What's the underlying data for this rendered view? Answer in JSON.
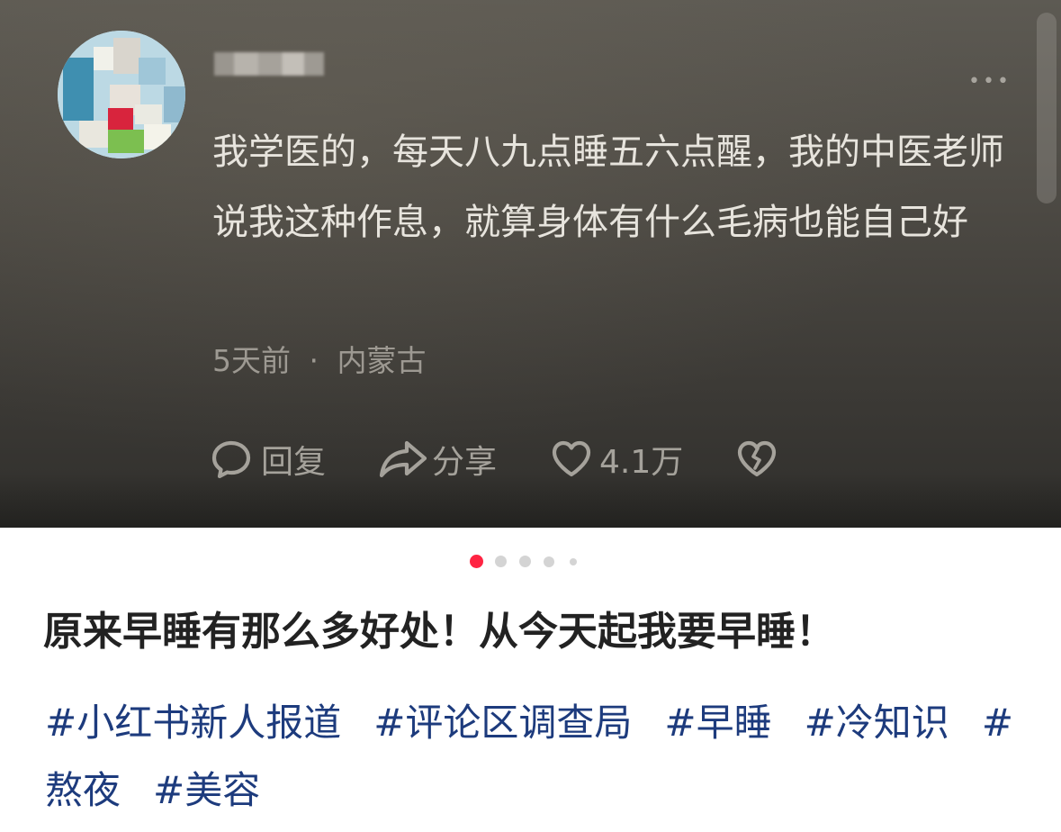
{
  "comment_card": {
    "comment_text": "我学医的，每天八九点睡五六点醒，我的中医老师说我这种作息，就算身体有什么毛病也能自己好",
    "time": "5天前",
    "separator": "·",
    "location": "内蒙古",
    "actions": {
      "reply_label": "回复",
      "share_label": "分享",
      "like_count": "4.1万"
    },
    "icons": {
      "reply": "speech-bubble-icon",
      "share": "share-arrow-icon",
      "like": "heart-icon",
      "dislike": "broken-heart-icon",
      "more": "more-dots-icon"
    }
  },
  "pager": {
    "total": 5,
    "active_index": 0,
    "active_color": "#ff2442",
    "inactive_color": "#d4d4d4"
  },
  "post": {
    "title": "原来早睡有那么多好处！从今天起我要早睡！",
    "tags": [
      "#小红书新人报道",
      "#评论区调查局",
      "#早睡",
      "#冷知识",
      "#熬夜",
      "#美容"
    ],
    "tag_color": "#1d3b7d"
  }
}
